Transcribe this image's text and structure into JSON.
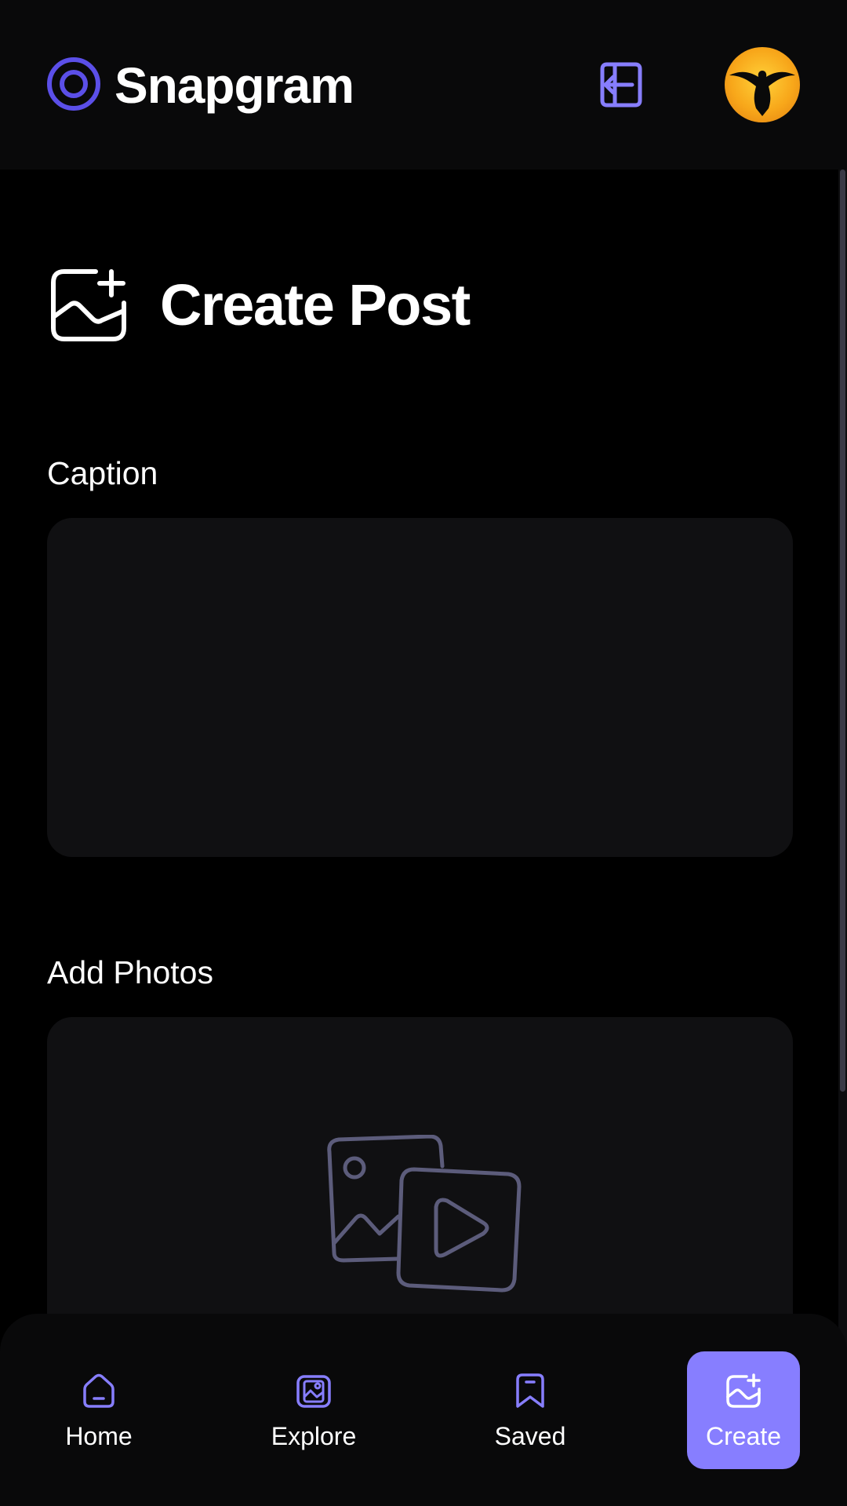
{
  "header": {
    "app_name": "Snapgram",
    "logout_icon": "logout-icon",
    "avatar": "user-avatar-eagle"
  },
  "page": {
    "title": "Create Post",
    "title_icon": "add-image-icon"
  },
  "form": {
    "caption_label": "Caption",
    "caption_value": "",
    "photos_label": "Add Photos",
    "upload_icon": "photo-video-icon"
  },
  "bottom_nav": {
    "items": [
      {
        "label": "Home",
        "icon": "home-icon",
        "active": false
      },
      {
        "label": "Explore",
        "icon": "explore-icon",
        "active": false
      },
      {
        "label": "Saved",
        "icon": "bookmark-icon",
        "active": false
      },
      {
        "label": "Create",
        "icon": "add-image-icon",
        "active": true
      }
    ]
  },
  "colors": {
    "accent": "#877eff",
    "logo": "#5b4fe8",
    "surface": "#101012",
    "topbar": "#09090a",
    "background": "#000000",
    "upload_icon": "#5c5c7b"
  }
}
